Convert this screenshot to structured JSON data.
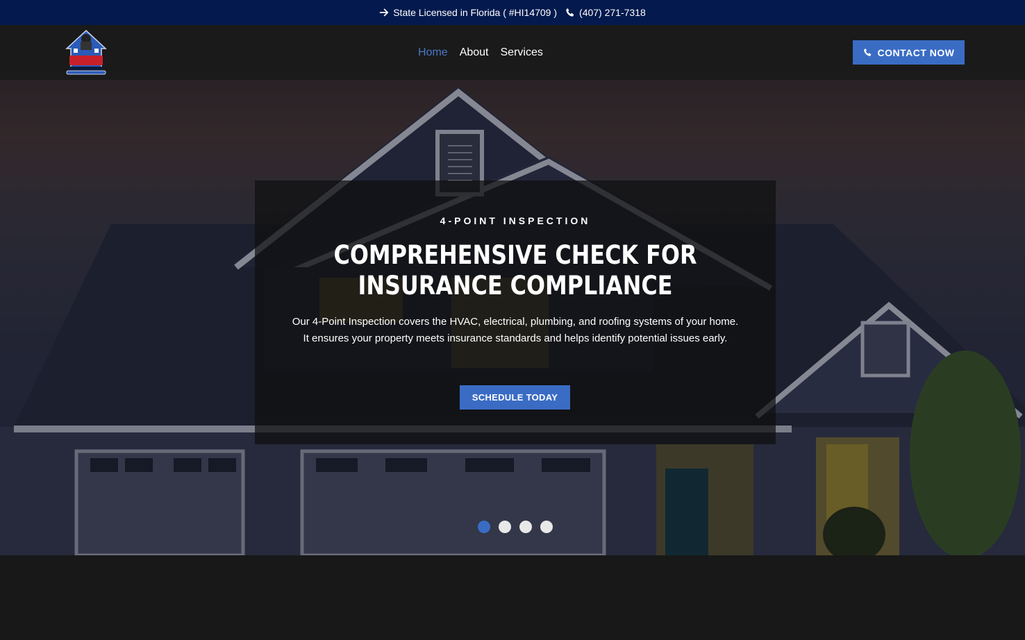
{
  "topbar": {
    "license_text": "State Licensed in Florida ( #HI14709 )",
    "phone": "(407) 271-7318",
    "license_icon": "arrow-right-icon",
    "phone_icon": "phone-icon"
  },
  "nav": {
    "logo_name": "S&L Home Inspections logo",
    "items": [
      {
        "label": "Home",
        "active": true
      },
      {
        "label": "About",
        "active": false
      },
      {
        "label": "Services",
        "active": false
      }
    ],
    "cta_label": "CONTACT NOW",
    "cta_icon": "phone-icon"
  },
  "hero": {
    "kicker": "4-POINT INSPECTION",
    "headline": "COMPREHENSIVE CHECK FOR INSURANCE COMPLIANCE",
    "description": "Our 4-Point Inspection covers the HVAC, electrical, plumbing, and roofing systems of your home. It ensures your property meets insurance standards and helps identify potential issues early.",
    "button_label": "SCHEDULE TODAY",
    "slides_total": 4,
    "active_slide": 1
  },
  "colors": {
    "topbar_bg": "#041a4e",
    "nav_bg": "#1a1a1a",
    "accent": "#3a6cc4",
    "active_link": "#4a78c8"
  }
}
